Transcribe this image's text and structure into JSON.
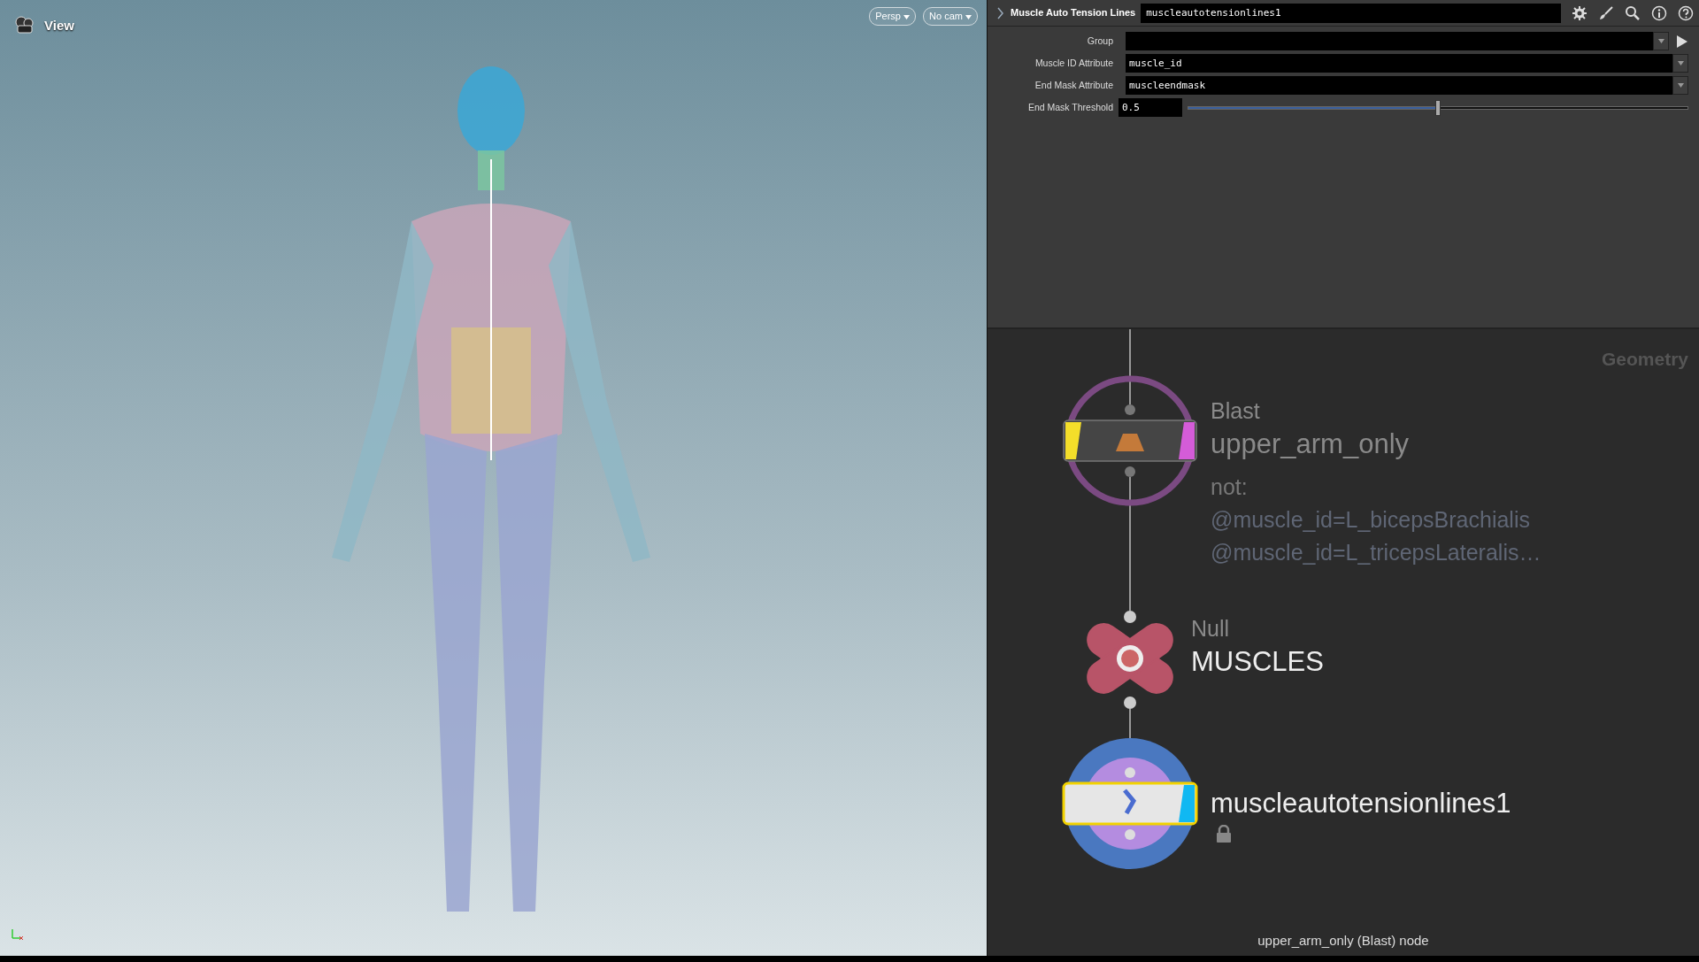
{
  "viewport": {
    "title": "View",
    "camera_menus": [
      "Persp",
      "No cam"
    ]
  },
  "parameters": {
    "node_type": "Muscle Auto Tension Lines",
    "node_name": "muscleautotensionlines1",
    "fields": [
      {
        "kind": "group",
        "label": "Group"
      },
      {
        "kind": "menu",
        "label": "Muscle ID Attribute",
        "value": "muscle_id"
      },
      {
        "kind": "menu",
        "label": "End Mask Attribute",
        "value": "muscleendmask"
      },
      {
        "kind": "slider",
        "label": "End Mask Threshold",
        "value": "0.5",
        "level": 0.5
      }
    ]
  },
  "network": {
    "context": "Geometry",
    "nodes": [
      {
        "kind": "blast",
        "type_label": "Blast",
        "name": "upper_arm_only",
        "bypass": true,
        "template": true,
        "selected": false,
        "comment": [
          "not:",
          "@muscle_id=L_bicepsBrachialis",
          "@muscle_id=L_tricepsLateralis…"
        ]
      },
      {
        "kind": "null",
        "type_label": "Null",
        "name": "MUSCLES",
        "selected": false
      },
      {
        "kind": "tension",
        "name": "muscleautotensionlines1",
        "display": true,
        "selected": true,
        "locked": true
      }
    ],
    "status": "upper_arm_only (Blast) node"
  }
}
